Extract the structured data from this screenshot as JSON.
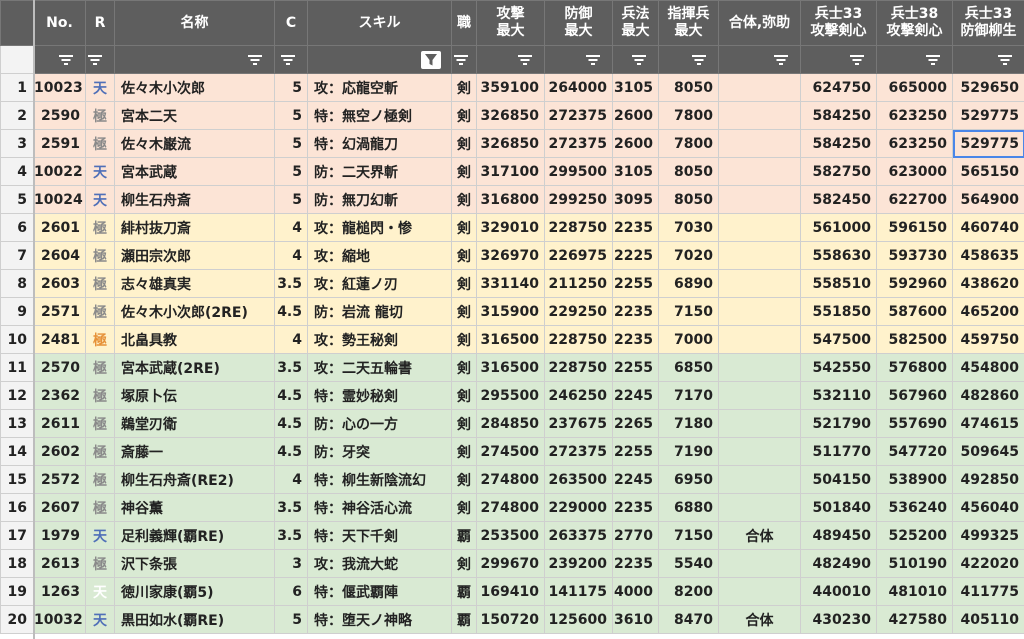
{
  "columns": [
    {
      "key": "no",
      "label": "No."
    },
    {
      "key": "r",
      "label": "R"
    },
    {
      "key": "name",
      "label": "名称"
    },
    {
      "key": "c",
      "label": "C"
    },
    {
      "key": "skill",
      "label": "スキル"
    },
    {
      "key": "job",
      "label": "職"
    },
    {
      "key": "atk",
      "label": "攻撃\n最大"
    },
    {
      "key": "def",
      "label": "防御\n最大"
    },
    {
      "key": "tac",
      "label": "兵法\n最大"
    },
    {
      "key": "cmd",
      "label": "指揮兵\n最大"
    },
    {
      "key": "aid",
      "label": "合体,弥助"
    },
    {
      "key": "s33a",
      "label": "兵士33\n攻撃剣心"
    },
    {
      "key": "s38a",
      "label": "兵士38\n攻撃剣心"
    },
    {
      "key": "s33d",
      "label": "兵士33\n防御柳生"
    }
  ],
  "active_filter_column": "skill",
  "rarity_colors": {
    "天": "#4f6fb8",
    "極": "#8a8a8a",
    "極_gold": "#e69138",
    "天_white": "#ffffff"
  },
  "rows": [
    {
      "rn": "1",
      "band": "pink",
      "no": "10023",
      "r": "天",
      "r_style": "blue",
      "name": "佐々木小次郎",
      "c": "5",
      "skill": "攻：応龍空斬",
      "job": "剣",
      "atk": "359100",
      "def": "264000",
      "tac": "3105",
      "cmd": "8050",
      "aid": "",
      "s33a": "624750",
      "s38a": "665000",
      "s33d": "529650"
    },
    {
      "rn": "2",
      "band": "pink",
      "no": "2590",
      "r": "極",
      "r_style": "gray",
      "name": "宮本二天",
      "c": "5",
      "skill": "特：無空ノ極剣",
      "job": "剣",
      "atk": "326850",
      "def": "272375",
      "tac": "2600",
      "cmd": "7800",
      "aid": "",
      "s33a": "584250",
      "s38a": "623250",
      "s33d": "529775"
    },
    {
      "rn": "3",
      "band": "pink",
      "no": "2591",
      "r": "極",
      "r_style": "gray",
      "name": "佐々木巌流",
      "c": "5",
      "skill": "特：幻渦龍刀",
      "job": "剣",
      "atk": "326850",
      "def": "272375",
      "tac": "2600",
      "cmd": "7800",
      "aid": "",
      "s33a": "584250",
      "s38a": "623250",
      "s33d": "529775"
    },
    {
      "rn": "4",
      "band": "pink",
      "no": "10022",
      "r": "天",
      "r_style": "blue",
      "name": "宮本武蔵",
      "c": "5",
      "skill": "防：二天界斬",
      "job": "剣",
      "atk": "317100",
      "def": "299500",
      "tac": "3105",
      "cmd": "8050",
      "aid": "",
      "s33a": "582750",
      "s38a": "623000",
      "s33d": "565150"
    },
    {
      "rn": "5",
      "band": "pink",
      "no": "10024",
      "r": "天",
      "r_style": "blue",
      "name": "柳生石舟斎",
      "c": "5",
      "skill": "防：無刀幻斬",
      "job": "剣",
      "atk": "316800",
      "def": "299250",
      "tac": "3095",
      "cmd": "8050",
      "aid": "",
      "s33a": "582450",
      "s38a": "622700",
      "s33d": "564900"
    },
    {
      "rn": "6",
      "band": "yellow",
      "no": "2601",
      "r": "極",
      "r_style": "gray",
      "name": "緋村抜刀斎",
      "c": "4",
      "skill": "攻：龍槌閃・惨",
      "job": "剣",
      "atk": "329010",
      "def": "228750",
      "tac": "2235",
      "cmd": "7030",
      "aid": "",
      "s33a": "561000",
      "s38a": "596150",
      "s33d": "460740"
    },
    {
      "rn": "7",
      "band": "yellow",
      "no": "2604",
      "r": "極",
      "r_style": "gray",
      "name": "瀬田宗次郎",
      "c": "4",
      "skill": "攻：縮地",
      "job": "剣",
      "atk": "326970",
      "def": "226975",
      "tac": "2225",
      "cmd": "7020",
      "aid": "",
      "s33a": "558630",
      "s38a": "593730",
      "s33d": "458635"
    },
    {
      "rn": "8",
      "band": "yellow",
      "no": "2603",
      "r": "極",
      "r_style": "gray",
      "name": "志々雄真実",
      "c": "3.5",
      "skill": "攻：紅蓮ノ刃",
      "job": "剣",
      "atk": "331140",
      "def": "211250",
      "tac": "2255",
      "cmd": "6890",
      "aid": "",
      "s33a": "558510",
      "s38a": "592960",
      "s33d": "438620"
    },
    {
      "rn": "9",
      "band": "yellow",
      "no": "2571",
      "r": "極",
      "r_style": "gray",
      "name": "佐々木小次郎(2RE)",
      "c": "4.5",
      "skill": "防：岩流 龍切",
      "job": "剣",
      "atk": "315900",
      "def": "229250",
      "tac": "2235",
      "cmd": "7150",
      "aid": "",
      "s33a": "551850",
      "s38a": "587600",
      "s33d": "465200"
    },
    {
      "rn": "10",
      "band": "yellow",
      "no": "2481",
      "r": "極",
      "r_style": "gold",
      "name": "北畠具教",
      "c": "4",
      "skill": "攻：勢王秘剣",
      "job": "剣",
      "atk": "316500",
      "def": "228750",
      "tac": "2235",
      "cmd": "7000",
      "aid": "",
      "s33a": "547500",
      "s38a": "582500",
      "s33d": "459750"
    },
    {
      "rn": "11",
      "band": "green",
      "no": "2570",
      "r": "極",
      "r_style": "gray",
      "name": "宮本武蔵(2RE)",
      "c": "3.5",
      "skill": "攻：二天五輪書",
      "job": "剣",
      "atk": "316500",
      "def": "228750",
      "tac": "2255",
      "cmd": "6850",
      "aid": "",
      "s33a": "542550",
      "s38a": "576800",
      "s33d": "454800"
    },
    {
      "rn": "12",
      "band": "green",
      "no": "2362",
      "r": "極",
      "r_style": "gray",
      "name": "塚原卜伝",
      "c": "4.5",
      "skill": "特：霊妙秘剣",
      "job": "剣",
      "atk": "295500",
      "def": "246250",
      "tac": "2245",
      "cmd": "7170",
      "aid": "",
      "s33a": "532110",
      "s38a": "567960",
      "s33d": "482860"
    },
    {
      "rn": "13",
      "band": "green",
      "no": "2611",
      "r": "極",
      "r_style": "gray",
      "name": "鵜堂刃衛",
      "c": "4.5",
      "skill": "防：心の一方",
      "job": "剣",
      "atk": "284850",
      "def": "237675",
      "tac": "2265",
      "cmd": "7180",
      "aid": "",
      "s33a": "521790",
      "s38a": "557690",
      "s33d": "474615"
    },
    {
      "rn": "14",
      "band": "green",
      "no": "2602",
      "r": "極",
      "r_style": "gray",
      "name": "斎藤一",
      "c": "4.5",
      "skill": "防：牙突",
      "job": "剣",
      "atk": "274500",
      "def": "272375",
      "tac": "2255",
      "cmd": "7190",
      "aid": "",
      "s33a": "511770",
      "s38a": "547720",
      "s33d": "509645"
    },
    {
      "rn": "15",
      "band": "green",
      "no": "2572",
      "r": "極",
      "r_style": "gray",
      "name": "柳生石舟斎(RE2)",
      "c": "4",
      "skill": "特：柳生新陰流幻",
      "job": "剣",
      "atk": "274800",
      "def": "263500",
      "tac": "2245",
      "cmd": "6950",
      "aid": "",
      "s33a": "504150",
      "s38a": "538900",
      "s33d": "492850"
    },
    {
      "rn": "16",
      "band": "green",
      "no": "2607",
      "r": "極",
      "r_style": "gray",
      "name": "神谷薫",
      "c": "3.5",
      "skill": "特：神谷活心流",
      "job": "剣",
      "atk": "274800",
      "def": "229000",
      "tac": "2235",
      "cmd": "6880",
      "aid": "",
      "s33a": "501840",
      "s38a": "536240",
      "s33d": "456040"
    },
    {
      "rn": "17",
      "band": "green",
      "no": "1979",
      "r": "天",
      "r_style": "blue",
      "name": "足利義輝(覇RE)",
      "c": "3.5",
      "skill": "特：天下千剣",
      "job": "覇",
      "atk": "253500",
      "def": "263375",
      "tac": "2770",
      "cmd": "7150",
      "aid": "合体",
      "s33a": "489450",
      "s38a": "525200",
      "s33d": "499325"
    },
    {
      "rn": "18",
      "band": "green",
      "no": "2613",
      "r": "極",
      "r_style": "gray",
      "name": "沢下条張",
      "c": "3",
      "skill": "攻：我流大蛇",
      "job": "剣",
      "atk": "299670",
      "def": "239200",
      "tac": "2235",
      "cmd": "5540",
      "aid": "",
      "s33a": "482490",
      "s38a": "510190",
      "s33d": "422020"
    },
    {
      "rn": "19",
      "band": "green",
      "no": "1263",
      "r": "天",
      "r_style": "white",
      "name": "徳川家康(覇5)",
      "c": "6",
      "skill": "特：偃武覇陣",
      "job": "覇",
      "atk": "169410",
      "def": "141175",
      "tac": "4000",
      "cmd": "8200",
      "aid": "",
      "s33a": "440010",
      "s38a": "481010",
      "s33d": "411775"
    },
    {
      "rn": "20",
      "band": "green",
      "no": "10032",
      "r": "天",
      "r_style": "blue",
      "name": "黒田如水(覇RE)",
      "c": "5",
      "skill": "特：堕天ノ神略",
      "job": "覇",
      "atk": "150720",
      "def": "125600",
      "tac": "3610",
      "cmd": "8470",
      "aid": "合体",
      "s33a": "430230",
      "s38a": "427580",
      "s33d": "405110"
    }
  ],
  "selected_cell": {
    "row": "3",
    "col": "s33d"
  }
}
